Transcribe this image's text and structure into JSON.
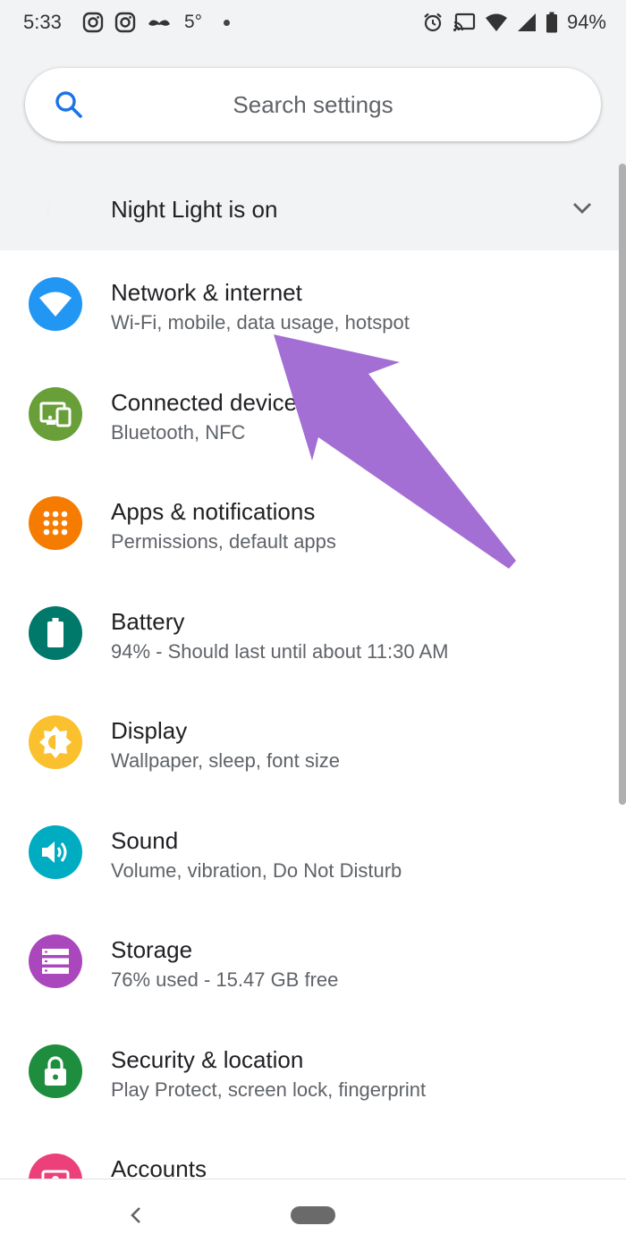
{
  "status_bar": {
    "time": "5:33",
    "temperature": "5°",
    "battery": "94%",
    "left_icons": [
      "instagram-icon",
      "instagram-icon",
      "mustache-icon"
    ],
    "right_icons": [
      "alarm-icon",
      "cast-icon",
      "wifi-icon",
      "signal-icon",
      "battery-icon"
    ]
  },
  "search": {
    "placeholder": "Search settings",
    "icon": "search-icon"
  },
  "night_light": {
    "label": "Night Light is on",
    "icon": "moon-icon"
  },
  "settings": [
    {
      "title": "Network & internet",
      "subtitle": "Wi-Fi, mobile, data usage, hotspot",
      "icon": "wifi-icon",
      "color": "#2196f3"
    },
    {
      "title": "Connected devices",
      "subtitle": "Bluetooth, NFC",
      "icon": "devices-icon",
      "color": "#689f38"
    },
    {
      "title": "Apps & notifications",
      "subtitle": "Permissions, default apps",
      "icon": "apps-grid-icon",
      "color": "#f57c00"
    },
    {
      "title": "Battery",
      "subtitle": "94% - Should last until about 11:30 AM",
      "icon": "battery-icon",
      "color": "#00796b"
    },
    {
      "title": "Display",
      "subtitle": "Wallpaper, sleep, font size",
      "icon": "brightness-icon",
      "color": "#fbc02d"
    },
    {
      "title": "Sound",
      "subtitle": "Volume, vibration, Do Not Disturb",
      "icon": "volume-icon",
      "color": "#00acc1"
    },
    {
      "title": "Storage",
      "subtitle": "76% used - 15.47 GB free",
      "icon": "storage-icon",
      "color": "#ab47bc"
    },
    {
      "title": "Security & location",
      "subtitle": "Play Protect, screen lock, fingerprint",
      "icon": "lock-icon",
      "color": "#1e8e3e"
    },
    {
      "title": "Accounts",
      "subtitle": "",
      "icon": "account-icon",
      "color": "#ec407a"
    }
  ],
  "annotation": {
    "color": "#a46fd4"
  },
  "colors": {
    "accent": "#1a73e8",
    "background": "#f1f3f4"
  }
}
